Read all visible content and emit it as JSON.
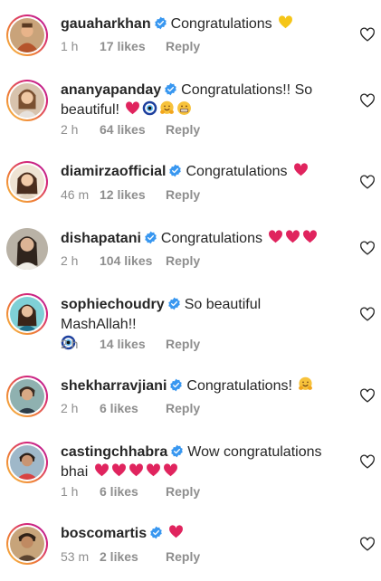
{
  "comments": [
    {
      "username": "gauaharkhan",
      "text": "Congratulations",
      "time": "1 h",
      "likes": "17 likes",
      "reply": "Reply",
      "emojis": [
        "yellow-heart"
      ]
    },
    {
      "username": "ananyapanday",
      "text": "Congratulations!! So beautiful!",
      "time": "2 h",
      "likes": "64 likes",
      "reply": "Reply",
      "emojis": [
        "red-heart",
        "nazar-amulet",
        "hugging-face",
        "grimacing-face"
      ]
    },
    {
      "username": "diamirzaofficial",
      "text": "Congratulations",
      "time": "46 m",
      "likes": "12 likes",
      "reply": "Reply",
      "emojis": [
        "red-heart"
      ]
    },
    {
      "username": "dishapatani",
      "text": "Congratulations",
      "time": "2 h",
      "likes": "104 likes",
      "reply": "Reply",
      "emojis": [
        "red-heart",
        "red-heart",
        "red-heart"
      ]
    },
    {
      "username": "sophiechoudry",
      "text": "So beautiful MashAllah!!",
      "time": "2 h",
      "likes": "14 likes",
      "reply": "Reply",
      "emojis": [
        "nazar-amulet"
      ]
    },
    {
      "username": "shekharravjiani",
      "text": "Congratulations!",
      "time": "2 h",
      "likes": "6 likes",
      "reply": "Reply",
      "emojis": [
        "hugging-face"
      ]
    },
    {
      "username": "castingchhabra",
      "text": "Wow congratulations bhai",
      "time": "1 h",
      "likes": "6 likes",
      "reply": "Reply",
      "emojis": [
        "red-heart",
        "red-heart",
        "red-heart",
        "red-heart",
        "red-heart"
      ]
    },
    {
      "username": "boscomartis",
      "text": "",
      "time": "53 m",
      "likes": "2 likes",
      "reply": "Reply",
      "emojis": [
        "red-heart"
      ]
    }
  ],
  "colors": {
    "verified": "#3897f0",
    "meta_text": "#8e8e8e",
    "heart_red": "#e0245e",
    "yellow_heart": "#f5c518"
  }
}
